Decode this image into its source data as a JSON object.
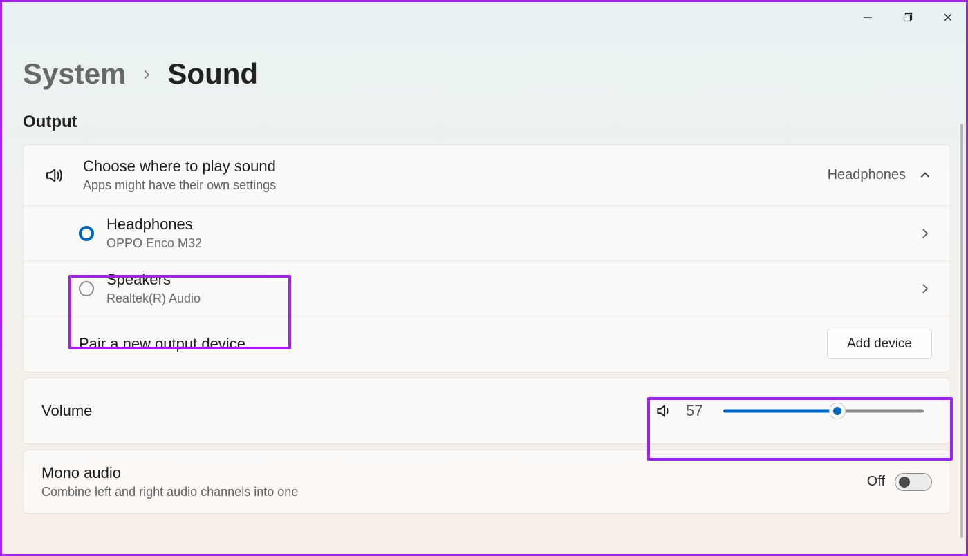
{
  "breadcrumb": {
    "system": "System",
    "sound": "Sound"
  },
  "sections": {
    "output_title": "Output",
    "choose": {
      "title": "Choose where to play sound",
      "subtitle": "Apps might have their own settings",
      "current": "Headphones"
    },
    "devices": [
      {
        "name": "Headphones",
        "sub": "OPPO Enco M32",
        "selected": true
      },
      {
        "name": "Speakers",
        "sub": "Realtek(R) Audio",
        "selected": false
      }
    ],
    "pair": {
      "label": "Pair a new output device",
      "button": "Add device"
    }
  },
  "volume": {
    "label": "Volume",
    "value": "57",
    "percent": 57
  },
  "mono": {
    "title": "Mono audio",
    "subtitle": "Combine left and right audio channels into one",
    "state": "Off"
  }
}
